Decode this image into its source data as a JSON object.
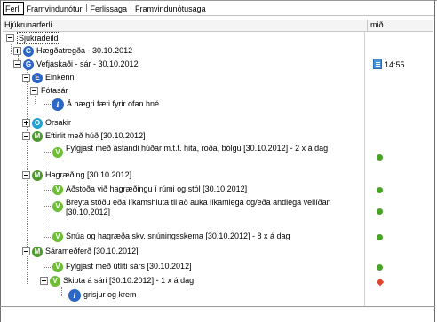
{
  "tabs": [
    {
      "label": "Ferli",
      "active": true
    },
    {
      "label": "Framvindunótur",
      "active": false
    },
    {
      "label": "Ferlissaga",
      "active": false
    },
    {
      "label": "Framvindunótusaga",
      "active": false
    }
  ],
  "columns": {
    "name": "Hjúkrunarferli",
    "mid": "mið."
  },
  "tree": {
    "root": "Sjúkradeild",
    "items": [
      {
        "label": "Hægðatregða - 30.10.2012",
        "icon": "G"
      },
      {
        "label": "Vefjaskaði - sár - 30.10.2012",
        "icon": "G",
        "time": "14:55"
      },
      {
        "label": "Einkenni",
        "icon": "E"
      },
      {
        "label": "Fótasár"
      },
      {
        "label": "Á hægri fæti fyrir ofan hné",
        "icon": "i"
      },
      {
        "label": "Orsakir",
        "icon": "O"
      },
      {
        "label": "Eftirlit með húð [30.10.2012]",
        "icon": "M"
      },
      {
        "label": "Fylgjast með ástandi húðar m.t.t. hita, roða, bólgu [30.10.2012] - 2 x á dag",
        "icon": "V"
      },
      {
        "label": "Hagræðing [30.10.2012]",
        "icon": "M"
      },
      {
        "label": "Aðstoða við hagræðingu í rúmi og stól [30.10.2012]",
        "icon": "V"
      },
      {
        "label": "Breyta stöðu eða líkamshluta til að auka líkamlega og/eða andlega vellíðan [30.10.2012]",
        "icon": "V"
      },
      {
        "label": "Snúa og hagræða skv. snúningsskema [30.10.2012] - 8 x á dag",
        "icon": "V"
      },
      {
        "label": "Sárameðferð [30.10.2012]",
        "icon": "M"
      },
      {
        "label": "Fylgjast með útliti sárs [30.10.2012]",
        "icon": "V"
      },
      {
        "label": "Skipta á sári [30.10.2012] - 1 x á dag",
        "icon": "V"
      },
      {
        "label": "grisjur og krem",
        "icon": "i"
      }
    ]
  },
  "colors": {
    "status_ok": "#48a326",
    "status_alert": "#e0442c",
    "icon_blue": "#2a67c9",
    "icon_green_dark": "#4f9a2f",
    "icon_green_light": "#6dbd35"
  }
}
